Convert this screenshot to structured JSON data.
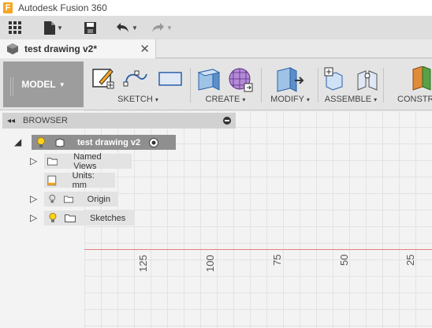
{
  "app": {
    "title": "Autodesk Fusion 360",
    "logo_letter": "F",
    "brand_color": "#f5a623"
  },
  "quick_access": {
    "icons": [
      "grid-menu-icon",
      "file-icon",
      "save-icon",
      "undo-icon",
      "redo-icon"
    ]
  },
  "document_tab": {
    "label": "test drawing v2*",
    "close": "✕"
  },
  "workspace": {
    "label": "MODEL"
  },
  "toolbar_groups": [
    {
      "id": "sketch",
      "label": "SKETCH",
      "caret": "▾"
    },
    {
      "id": "create",
      "label": "CREATE",
      "caret": "▾"
    },
    {
      "id": "modify",
      "label": "MODIFY",
      "caret": "▾"
    },
    {
      "id": "assemble",
      "label": "ASSEMBLE",
      "caret": "▾"
    },
    {
      "id": "construct",
      "label": "CONSTRU"
    }
  ],
  "browser": {
    "title": "BROWSER",
    "collapse": "◂◂",
    "root": {
      "label": "test drawing v2"
    },
    "items": [
      {
        "label": "Named Views"
      },
      {
        "label": "Units: mm"
      },
      {
        "label": "Origin"
      },
      {
        "label": "Sketches"
      }
    ]
  },
  "ruler": {
    "ticks": [
      "125",
      "100",
      "75",
      "50",
      "25"
    ]
  },
  "colors": {
    "model_button": "#9d9d9d",
    "toolbar": "#e4e4e4",
    "axis_red": "#e08080",
    "accent_blue": "#2b5fa8"
  }
}
